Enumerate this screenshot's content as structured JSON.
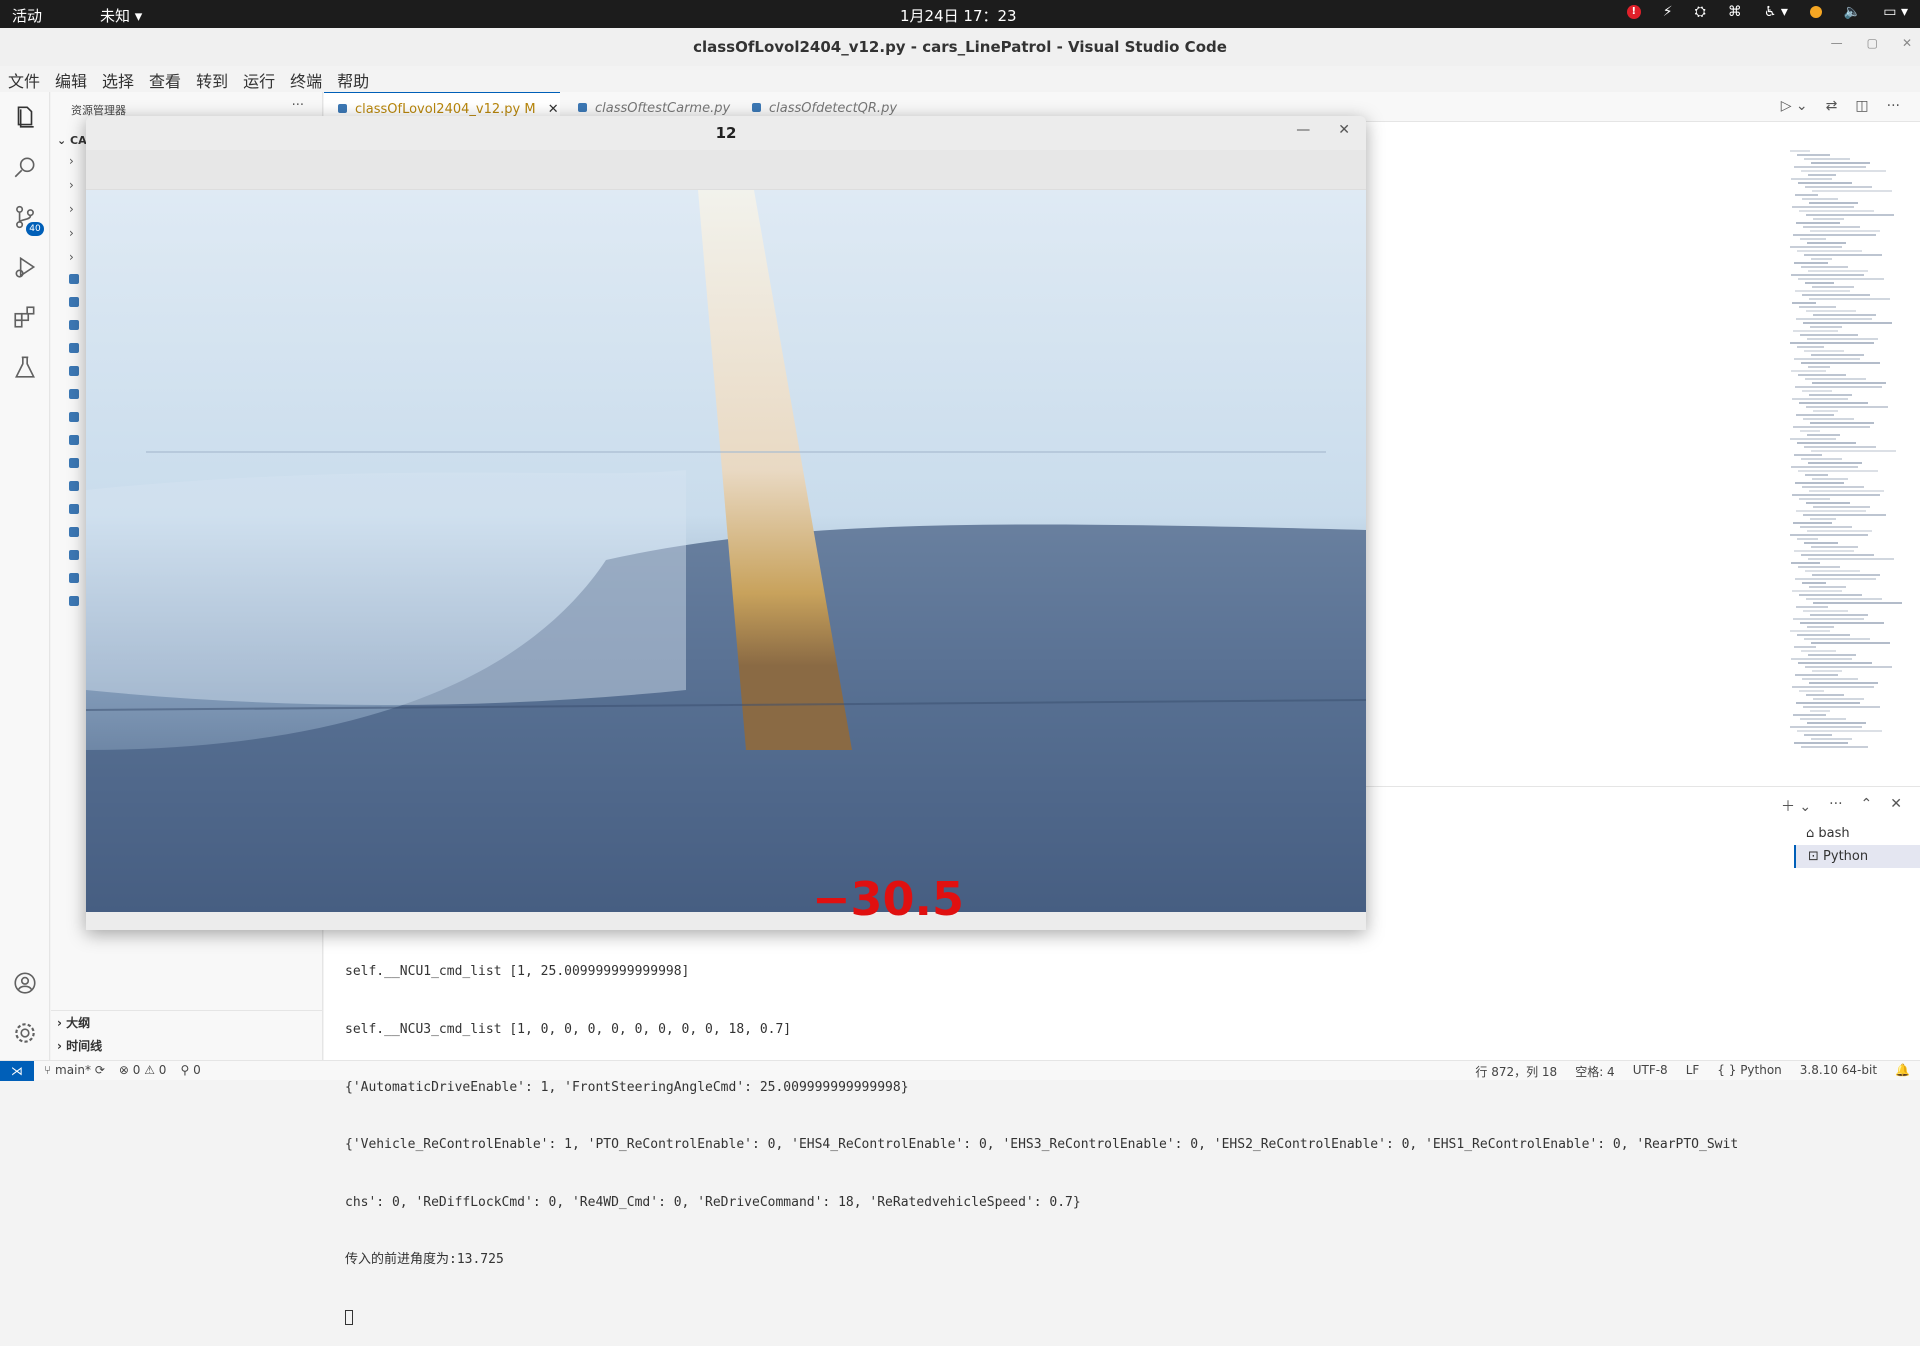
{
  "topbar": {
    "activities": "活动",
    "app_menu": "未知",
    "clock": "1月24日  17：23"
  },
  "window": {
    "title": "classOfLovol2404_v12.py - cars_LinePatrol - Visual Studio Code"
  },
  "menu": [
    "文件",
    "编辑",
    "选择",
    "查看",
    "转到",
    "运行",
    "终端",
    "帮助"
  ],
  "activity": {
    "scm_badge": "40"
  },
  "sidebar": {
    "header": "资源管理器",
    "folder": "CA",
    "outline": "大纲",
    "timeline": "时间线"
  },
  "tabs": [
    {
      "label": "classOfLovol2404_v12.py",
      "modified": "M"
    },
    {
      "label": "classOftestCarme.py"
    },
    {
      "label": "classOfdetectQR.py"
    }
  ],
  "camera_window": {
    "title": "12",
    "angle_overlay": "−30.5"
  },
  "terminal": {
    "lines": [
      "self.__NCU1_cmd_list [1, 25.009999999999998]",
      "self.__NCU3_cmd_list [1, 0, 0, 0, 0, 0, 0, 0, 0, 18, 0.7]",
      "{'AutomaticDriveEnable': 1, 'FrontSteeringAngleCmd': 25.009999999999998}",
      "{'Vehicle_ReControlEnable': 1, 'PTO_ReControlEnable': 0, 'EHS4_ReControlEnable': 0, 'EHS3_ReControlEnable': 0, 'EHS2_ReControlEnable': 0, 'EHS1_ReControlEnable': 0, 'RearPTO_Swit",
      "chs': 0, 'ReDiffLockCmd': 0, 'Re4WD_Cmd': 0, 'ReDriveCommand': 18, 'ReRatedvehicleSpeed': 0.7}",
      "传入的前进角度为:13.725"
    ],
    "list": [
      "bash",
      "Python"
    ]
  },
  "statusbar": {
    "branch": "main*",
    "errors": "0",
    "warnings": "0",
    "ports": "0",
    "position": "行 872，列 18",
    "spaces": "空格: 4",
    "encoding": "UTF-8",
    "eol": "LF",
    "language": "Python",
    "interpreter": "3.8.10 64-bit"
  },
  "colors": {
    "accent": "#005fb8",
    "angle_text": "#e01010"
  }
}
